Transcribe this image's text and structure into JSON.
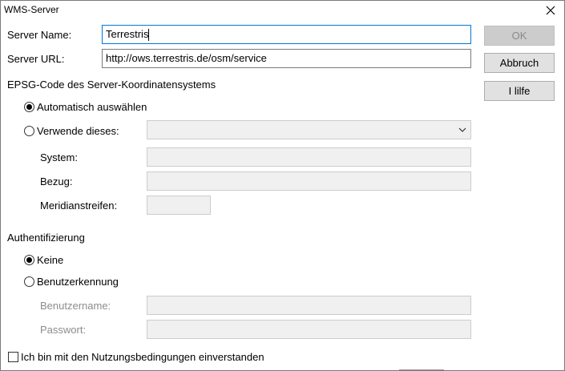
{
  "window": {
    "title": "WMS-Server"
  },
  "icons": {
    "close": "close-icon",
    "dropdown": "chevron-down-icon"
  },
  "colors": {
    "focus_border": "#0078d7",
    "button_bg": "#e1e1e1",
    "disabled_bg": "#f0f0f0"
  },
  "server": {
    "name_label": "Server Name:",
    "name_value": "Terrestris",
    "url_label": "Server URL:",
    "url_value": "http://ows.terrestris.de/osm/service"
  },
  "buttons": {
    "ok": "OK",
    "cancel": "Abbruch",
    "help": "I lilfe"
  },
  "epsg": {
    "heading": "EPSG-Code des Server-Koordinatensystems",
    "auto_label": "Automatisch auswählen",
    "use_label": "Verwende dieses:",
    "combo_value": "",
    "system_label": "System:",
    "system_value": "",
    "bezug_label": "Bezug:",
    "bezug_value": "",
    "meridian_label": "Meridianstreifen:",
    "meridian_value": "",
    "selected": "auto"
  },
  "auth": {
    "heading": "Authentifizierung",
    "none_label": "Keine",
    "user_label": "Benutzerkennung",
    "username_label": "Benutzername:",
    "username_value": "",
    "password_label": "Passwort:",
    "password_value": "",
    "selected": "none"
  },
  "terms": {
    "label": "Ich bin mit den Nutzungsbedingungen einverstanden",
    "checked": false
  }
}
